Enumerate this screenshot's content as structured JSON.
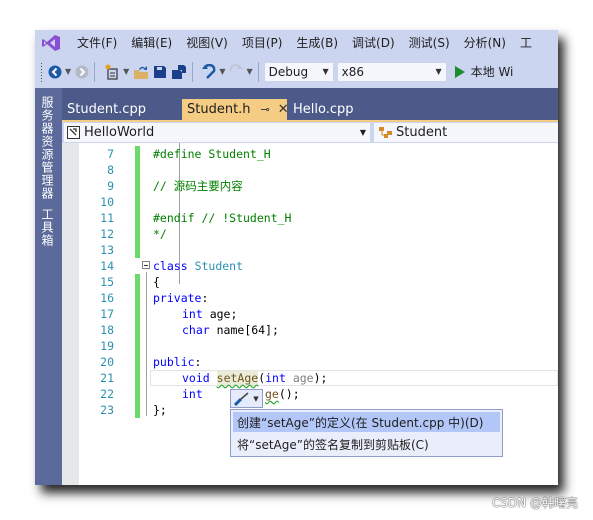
{
  "menubar": {
    "logo": "visual-studio-logo",
    "items": [
      "文件(F)",
      "编辑(E)",
      "视图(V)",
      "项目(P)",
      "生成(B)",
      "调试(D)",
      "测试(S)",
      "分析(N)",
      "工"
    ]
  },
  "toolbar": {
    "icons": [
      "back-icon",
      "forward-icon",
      "new-project-icon",
      "open-file-icon",
      "save-icon",
      "save-all-icon",
      "undo-icon",
      "redo-icon"
    ],
    "config": "Debug",
    "platform": "x86",
    "run_label": "本地 Wi"
  },
  "left_rail": {
    "items": [
      "服务器资源管理器",
      "工具箱"
    ]
  },
  "tabs": [
    {
      "label": "Student.cpp",
      "active": false
    },
    {
      "label": "Student.h",
      "active": true
    },
    {
      "label": "Hello.cpp",
      "active": false
    }
  ],
  "tab_icons": {
    "pin": "⊸",
    "close": "✕"
  },
  "navbar": {
    "project": "HelloWorld",
    "scope": "Student"
  },
  "code_lines": [
    {
      "n": "7",
      "text": "#define Student_H"
    },
    {
      "n": "8",
      "text": ""
    },
    {
      "n": "9",
      "text": "// 源码主要内容"
    },
    {
      "n": "10",
      "text": ""
    },
    {
      "n": "11",
      "text": "#endif // !Student_H"
    },
    {
      "n": "12",
      "text": "*/"
    },
    {
      "n": "13",
      "text": ""
    },
    {
      "n": "14",
      "text": "class Student"
    },
    {
      "n": "15",
      "text": "{"
    },
    {
      "n": "16",
      "text": "private:"
    },
    {
      "n": "17",
      "text": "    int age;"
    },
    {
      "n": "18",
      "text": "    char name[64];"
    },
    {
      "n": "19",
      "text": ""
    },
    {
      "n": "20",
      "text": "public:"
    },
    {
      "n": "21",
      "text": "    void setAge(int age);"
    },
    {
      "n": "22",
      "text": "    int getAge();"
    },
    {
      "n": "23",
      "text": "};"
    }
  ],
  "tokens": {
    "l7": "#define Student_H",
    "l9": "// 源码主要内容",
    "l11": "#endif // !Student_H",
    "l12": "*/",
    "class_kw": "class",
    "class_name": "Student",
    "brace_open": "{",
    "private_kw": "private",
    "colon": ":",
    "int_kw": "int",
    "age_field": " age;",
    "char_kw": "char",
    "name_field": " name[64];",
    "public_kw": "public",
    "void_kw": "void",
    "set_age": "setAge",
    "paren_open": "(",
    "param_age": " age",
    "paren_close": ");",
    "get_age_tail": "ge",
    "get_age_rest": "();",
    "brace_close": "};"
  },
  "quick_actions": {
    "icon": "screwdriver-icon",
    "items": [
      {
        "label": "创建“setAge”的定义(在 Student.cpp 中)(D)",
        "selected": true
      },
      {
        "label": "将“setAge”的签名复制到剪贴板(C)",
        "selected": false
      }
    ]
  },
  "watermark": "CSDN @韩曙亮"
}
